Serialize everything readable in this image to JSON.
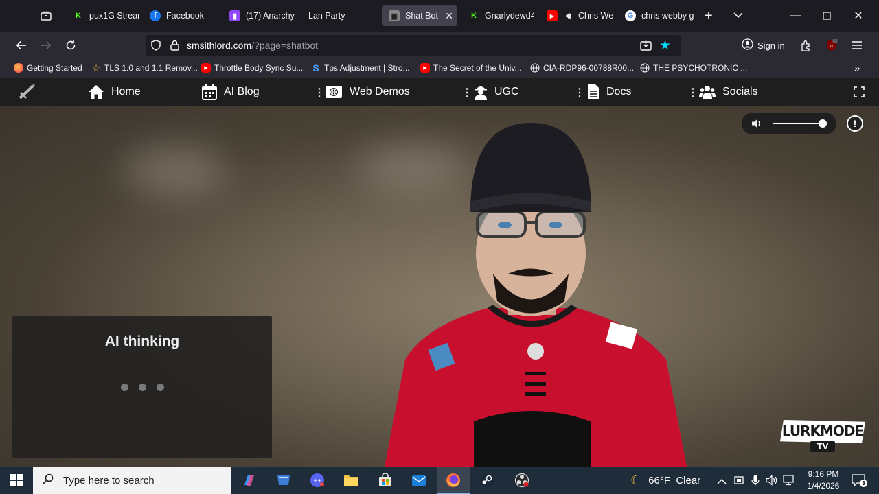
{
  "browser": {
    "tabs": [
      {
        "label": "pux1G Stream",
        "icon": "kick-icon",
        "color": "#53fc18"
      },
      {
        "label": "Facebook",
        "icon": "facebook-icon",
        "color": "#1877f2"
      },
      {
        "label": "(17) AnarchyA",
        "icon": "twitch-icon",
        "color": "#9146ff"
      },
      {
        "label": "Lan Party",
        "icon": "",
        "color": ""
      },
      {
        "label": "Shat Bot - ",
        "icon": "shatbot-icon",
        "color": "#888888",
        "active": true
      },
      {
        "label": "Gnarlydewd4",
        "icon": "kick-icon",
        "color": "#53fc18"
      },
      {
        "label": "Chris We",
        "icon": "youtube-icon",
        "color": "#ff0000"
      },
      {
        "label": "chris webby g",
        "icon": "google-icon",
        "color": "#4285f4"
      }
    ],
    "url_domain": "smsithlord.com",
    "url_path": "/?page=shatbot",
    "signin_label": "Sign in",
    "bookmarks": [
      {
        "label": "Getting Started",
        "icon": "firefox-icon"
      },
      {
        "label": "TLS 1.0 and 1.1 Remov...",
        "icon": "star-icon"
      },
      {
        "label": "Throttle Body Sync Su...",
        "icon": "youtube-icon"
      },
      {
        "label": "Tps Adjustment | Stro...",
        "icon": "s-icon"
      },
      {
        "label": "The Secret of the Univ...",
        "icon": "youtube-icon"
      },
      {
        "label": "CIA-RDP96-00788R00...",
        "icon": "globe-icon"
      },
      {
        "label": "THE PSYCHOTRONIC ...",
        "icon": "globe-icon"
      }
    ]
  },
  "site_nav": {
    "items": [
      {
        "label": "Home",
        "icon": "home-icon"
      },
      {
        "label": "AI Blog",
        "icon": "calendar-icon"
      },
      {
        "label": "Web Demos",
        "icon": "globe-screen-icon"
      },
      {
        "label": "UGC",
        "icon": "user-secret-icon"
      },
      {
        "label": "Docs",
        "icon": "document-icon"
      },
      {
        "label": "Socials",
        "icon": "users-icon"
      }
    ]
  },
  "stage": {
    "status_title": "AI thinking",
    "volume_level": 0.93,
    "watermark_top": "LURKMODE",
    "watermark_bottom": "TV"
  },
  "taskbar": {
    "search_placeholder": "Type here to search",
    "weather": "66°F  Clear",
    "time": "9:16 PM",
    "date": "1/4/2026",
    "notification_count": "3"
  }
}
